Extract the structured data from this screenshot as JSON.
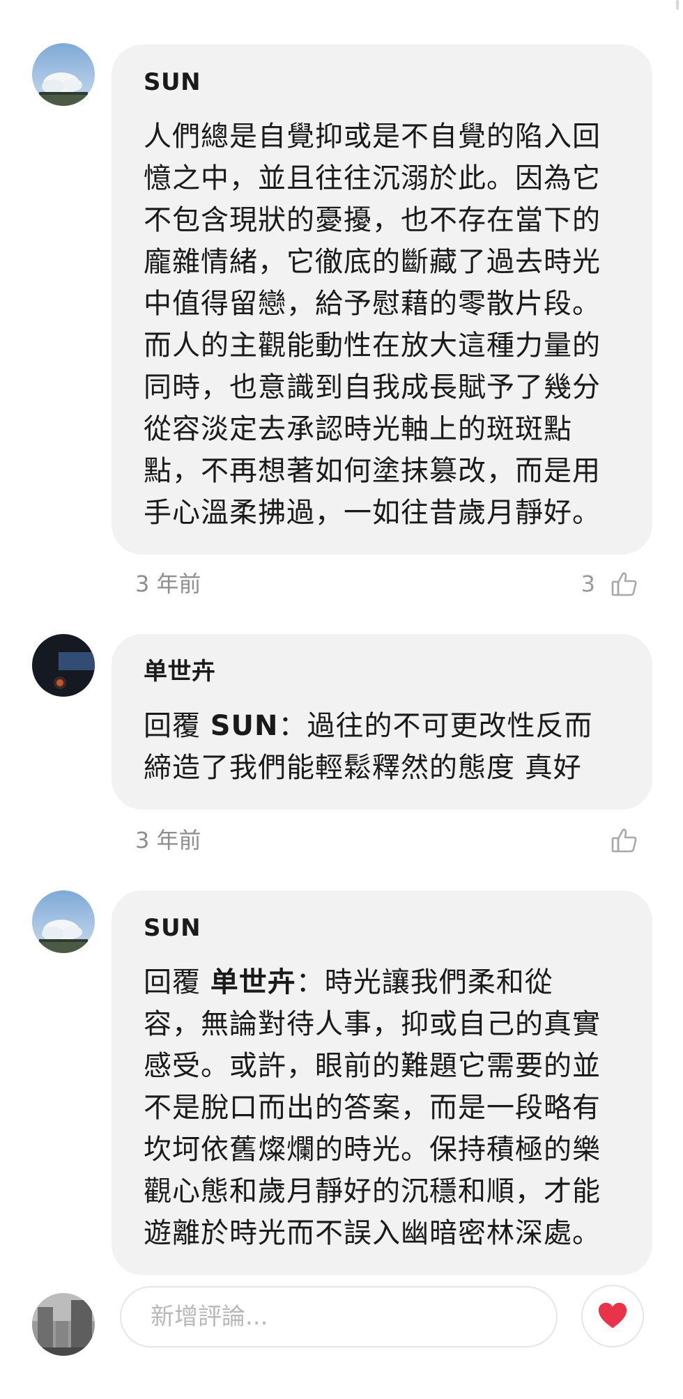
{
  "comments": [
    {
      "author": "SUN",
      "text": "人們總是自覺抑或是不自覺的陷入回\n憶之中，並且往往沉溺於此。因為它\n不包含現狀的憂擾，也不存在當下的\n龐雜情緒，它徹底的斷藏了過去時光\n中值得留戀，給予慰藉的零散片段。\n而人的主觀能動性在放大這種力量的\n同時，也意識到自我成長賦予了幾分\n從容淡定去承認時光軸上的斑斑點\n點，不再想著如何塗抹篡改，而是用\n手心溫柔拂過，一如往昔歲月靜好。",
      "time": "3 年前",
      "likes": "3",
      "avatar_icon": "sky-clouds-avatar"
    },
    {
      "author": "单世卉",
      "reply_prefix": "回覆 ",
      "reply_to": "SUN",
      "text": "：過往的不可更改性反而\n締造了我們能輕鬆釋然的態度 真好",
      "time": "3 年前",
      "likes": "",
      "avatar_icon": "dark-night-avatar"
    },
    {
      "author": "SUN",
      "reply_prefix": "回覆 ",
      "reply_to": "单世卉",
      "text": "：時光讓我們柔和從\n容，無論對待人事，抑或自己的真實\n感受。或許，眼前的難題它需要的並\n不是脫口而出的答案，而是一段略有\n坎坷依舊燦爛的時光。保持積極的樂\n觀心態和歲月靜好的沉穩和順，才能\n遊離於時光而不誤入幽暗密林深處。",
      "avatar_icon": "sky-clouds-avatar"
    }
  ],
  "composer": {
    "placeholder": "新增評論...",
    "heart_color": "#e8334a",
    "avatar_icon": "street-photo-avatar"
  }
}
